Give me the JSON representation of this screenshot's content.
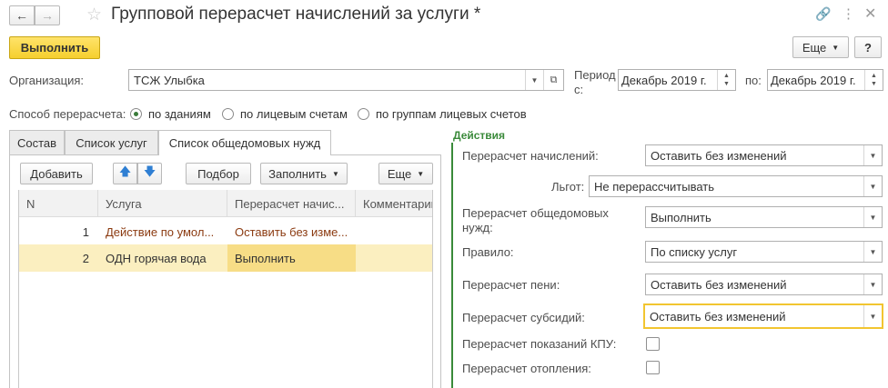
{
  "window": {
    "title": "Групповой перерасчет начислений за услуги *"
  },
  "toolbar": {
    "execute_label": "Выполнить",
    "more_label": "Еще"
  },
  "form": {
    "org_label": "Организация:",
    "org_value": "ТСЖ Улыбка",
    "period_label_1": "Период",
    "period_label_2": "с:",
    "period_from": "Декабрь 2019 г.",
    "period_to_label": "по:",
    "period_to": "Декабрь 2019 г.",
    "method_label": "Способ перерасчета:",
    "methods": [
      "по зданиям",
      "по лицевым счетам",
      "по группам лицевых счетов"
    ],
    "method_selected": 0
  },
  "tabs": [
    {
      "label": "Состав"
    },
    {
      "label": "Список услуг"
    },
    {
      "label": "Список общедомовых нужд"
    }
  ],
  "table_toolbar": {
    "add": "Добавить",
    "select": "Подбор",
    "fill": "Заполнить",
    "more": "Еще"
  },
  "table": {
    "columns": [
      "N",
      "Услуга",
      "Перерасчет начис...",
      "Комментарий"
    ],
    "rows": [
      {
        "n": "1",
        "service": "Действие по умол...",
        "recalc": "Оставить без изме...",
        "comment": ""
      },
      {
        "n": "2",
        "service": "ОДН горячая вода",
        "recalc": "Выполнить",
        "comment": ""
      }
    ]
  },
  "actions": {
    "title": "Действия",
    "accruals_label": "Перерасчет начислений:",
    "accruals_value": "Оставить без изменений",
    "benefits_label": "Льгот:",
    "benefits_value": "Не перерассчитывать",
    "odn_label_1": "Перерасчет общедомовых",
    "odn_label_2": "нужд:",
    "odn_value": "Выполнить",
    "rule_label": "Правило:",
    "rule_value": "По списку услуг",
    "penalty_label": "Перерасчет пени:",
    "penalty_value": "Оставить без изменений",
    "subsidy_label": "Перерасчет субсидий:",
    "subsidy_value": "Оставить без изменений",
    "kpu_label": "Перерасчет показаний КПУ:",
    "heating_label": "Перерасчет отопления:"
  },
  "colors": {
    "accent_yellow": "#f7d74a",
    "green": "#3a7b3a",
    "row_selected": "#fbefc0"
  }
}
